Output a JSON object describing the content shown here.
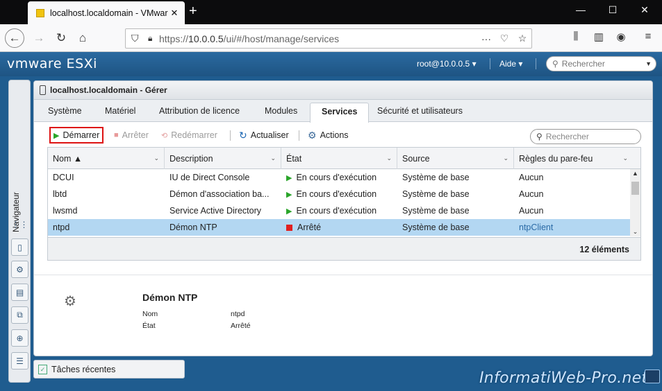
{
  "browser": {
    "tab_title": "localhost.localdomain - VMware",
    "url_prefix": "https://",
    "url_host": "10.0.0.5",
    "url_path": "/ui/#/host/manage/services"
  },
  "esxi": {
    "logo": "vmware ESXi",
    "user": "root@10.0.0.5 ▾",
    "help": "Aide ▾",
    "search_placeholder": "Rechercher"
  },
  "navigator": {
    "label": "Navigateur"
  },
  "panel": {
    "title": "localhost.localdomain - Gérer",
    "tabs": [
      "Système",
      "Matériel",
      "Attribution de licence",
      "Modules",
      "Services",
      "Sécurité et utilisateurs"
    ],
    "active_tab": "Services"
  },
  "toolbar": {
    "start": "Démarrer",
    "stop": "Arrêter",
    "restart": "Redémarrer",
    "refresh": "Actualiser",
    "actions": "Actions",
    "search_placeholder": "Rechercher"
  },
  "table": {
    "columns": [
      "Nom ▲",
      "Description",
      "État",
      "Source",
      "Règles du pare-feu"
    ],
    "rows": [
      {
        "name": "DCUI",
        "description": "IU de Direct Console",
        "state": "En cours d'exécution",
        "source": "Système de base",
        "firewall": "Aucun"
      },
      {
        "name": "lbtd",
        "description": "Démon d'association ba...",
        "state": "En cours d'exécution",
        "source": "Système de base",
        "firewall": "Aucun"
      },
      {
        "name": "lwsmd",
        "description": "Service Active Directory",
        "state": "En cours d'exécution",
        "source": "Système de base",
        "firewall": "Aucun"
      },
      {
        "name": "ntpd",
        "description": "Démon NTP",
        "state": "Arrêté",
        "source": "Système de base",
        "firewall": "ntpClient"
      }
    ],
    "count": "12 éléments"
  },
  "details": {
    "title": "Démon NTP",
    "name_label": "Nom",
    "name_value": "ntpd",
    "state_label": "État",
    "state_value": "Arrêté"
  },
  "tasks": {
    "label": "Tâches récentes"
  },
  "watermark": "InformatiWeb-Pro.net"
}
